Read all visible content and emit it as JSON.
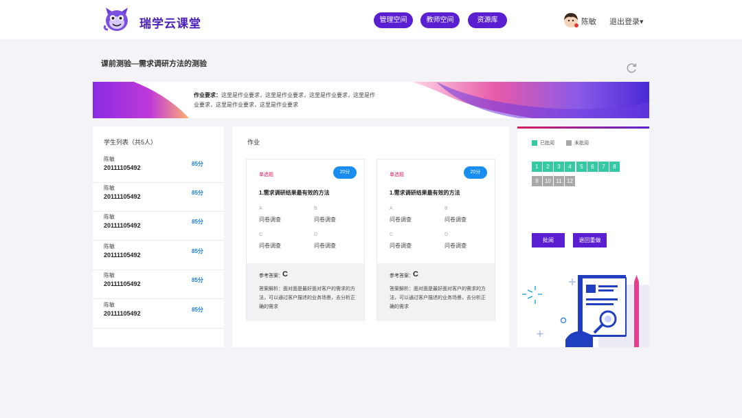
{
  "header": {
    "brand": "瑞学云课堂",
    "nav": [
      "管理空间",
      "教师空间",
      "资源库"
    ],
    "user_name": "陈敏",
    "logout": "退出登录▾"
  },
  "page": {
    "title": "课前测验—需求调研方法的测验",
    "requirement_label": "作业要求：",
    "requirement_text": "这里是作业要求，这里是作业要求，这里是作业要求，这里是作业要求，这里是作业要求，这里是作业要求"
  },
  "students": {
    "title": "学生列表（共5人）",
    "items": [
      {
        "name": "陈敏",
        "id": "20111105492",
        "score": "85分"
      },
      {
        "name": "陈敏",
        "id": "20111105492",
        "score": "85分"
      },
      {
        "name": "陈敏",
        "id": "20111105492",
        "score": "85分"
      },
      {
        "name": "陈敏",
        "id": "20111105492",
        "score": "85分"
      },
      {
        "name": "陈敏",
        "id": "20111105492",
        "score": "85分"
      },
      {
        "name": "陈敏",
        "id": "20111105492",
        "score": "85分"
      }
    ]
  },
  "homework": {
    "title": "作业",
    "questions": [
      {
        "type": "单选题",
        "points": "20分",
        "text": "1.需求调研结果最有效的方法",
        "options": [
          {
            "key": "A",
            "value": "问卷调查"
          },
          {
            "key": "B",
            "value": "问卷调查"
          },
          {
            "key": "C",
            "value": "问卷调查"
          },
          {
            "key": "D",
            "value": "问卷调查"
          }
        ],
        "answer_label": "参考答案：",
        "answer": "C",
        "analysis": "答案解析：面对面是最好面对客户的需求的方法，可以通过客户描述的业务场景，去分析正确的需求"
      },
      {
        "type": "单选题",
        "points": "20分",
        "text": "1.需求调研结果最有效的方法",
        "options": [
          {
            "key": "A",
            "value": "问卷调查"
          },
          {
            "key": "B",
            "value": "问卷调查"
          },
          {
            "key": "C",
            "value": "问卷调查"
          },
          {
            "key": "D",
            "value": "问卷调查"
          }
        ],
        "answer_label": "参考答案：",
        "answer": "C",
        "analysis": "答案解析：面对面是最好面对客户的需求的方法，可以通过客户描述的业务场景，去分析正确的需求"
      }
    ]
  },
  "review": {
    "legend_done": "已批阅",
    "legend_todo": "未批阅",
    "done_numbers": [
      "1",
      "2",
      "3",
      "4",
      "5",
      "6",
      "7",
      "8"
    ],
    "todo_numbers": [
      "9",
      "10",
      "11",
      "12"
    ],
    "btn_review": "批阅",
    "btn_return": "退回重做",
    "colors": {
      "done": "#36c9a4",
      "todo": "#a8a8a8",
      "accent": "#5a1fd1"
    }
  }
}
